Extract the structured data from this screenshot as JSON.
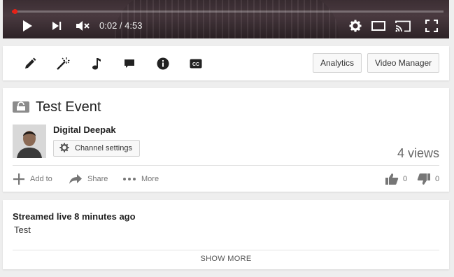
{
  "player": {
    "progress_fraction": 0.007,
    "time_display": "0:02 / 4:53",
    "icons": [
      "play-icon",
      "next-icon",
      "mute-icon",
      "settings-icon",
      "theater-mode-icon",
      "cast-icon",
      "fullscreen-icon"
    ],
    "accent_color": "#e62117"
  },
  "toolbar": {
    "tools": [
      "pencil-icon",
      "magic-wand-icon",
      "music-note-icon",
      "annotations-icon",
      "info-icon",
      "captions-icon"
    ],
    "captions_badge": "CC",
    "analytics_label": "Analytics",
    "video_manager_label": "Video Manager"
  },
  "video": {
    "title": "Test Event",
    "channel_name": "Digital Deepak",
    "channel_settings_label": "Channel settings",
    "views": "4 views",
    "actions": {
      "add_to": "Add to",
      "share": "Share",
      "more": "More"
    },
    "likes": "0",
    "dislikes": "0"
  },
  "description": {
    "streamed": "Streamed live 8 minutes ago",
    "text": "Test",
    "show_more": "SHOW MORE"
  }
}
